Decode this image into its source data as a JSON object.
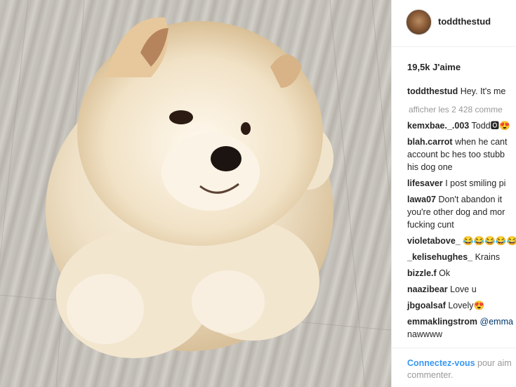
{
  "post": {
    "photo_alt": "fluffy cream chow chow puppy lying on wooden floor"
  },
  "header": {
    "username": "toddthestud"
  },
  "likes": {
    "text": "19,5k J'aime"
  },
  "caption": {
    "username": "toddthestud",
    "text": "Hey. It's me"
  },
  "view_all": {
    "text": "afficher les 2 428 comme"
  },
  "comments": [
    {
      "user": "kemxbae._.003",
      "lines": [
        "Todd🅾😍"
      ]
    },
    {
      "user": "blah.carrot",
      "lines": [
        "when he cant",
        "account bc hes too stubb",
        "his dog one"
      ]
    },
    {
      "user": "lifesaver",
      "lines": [
        "I post smiling pi"
      ]
    },
    {
      "user": "lawa07",
      "lines": [
        "Don't abandon it",
        "you're other dog and mor",
        "fucking cunt"
      ]
    },
    {
      "user": "violetabove_",
      "lines": [
        "😂😂😂😂😂"
      ]
    },
    {
      "user": "_kelisehughes_",
      "lines": [
        "Krains"
      ]
    },
    {
      "user": "bizzle.f",
      "lines": [
        "Ok"
      ]
    },
    {
      "user": "naazibear",
      "lines": [
        "Love u"
      ]
    },
    {
      "user": "jbgoalsaf",
      "lines": [
        "Lovely😍"
      ]
    },
    {
      "user": "emmaklingstrom",
      "mention": "@emma",
      "lines": [
        "nawwww"
      ]
    }
  ],
  "footer": {
    "login_link": "Connectez-vous",
    "text_1": "pour aim",
    "text_2": "commenter."
  }
}
